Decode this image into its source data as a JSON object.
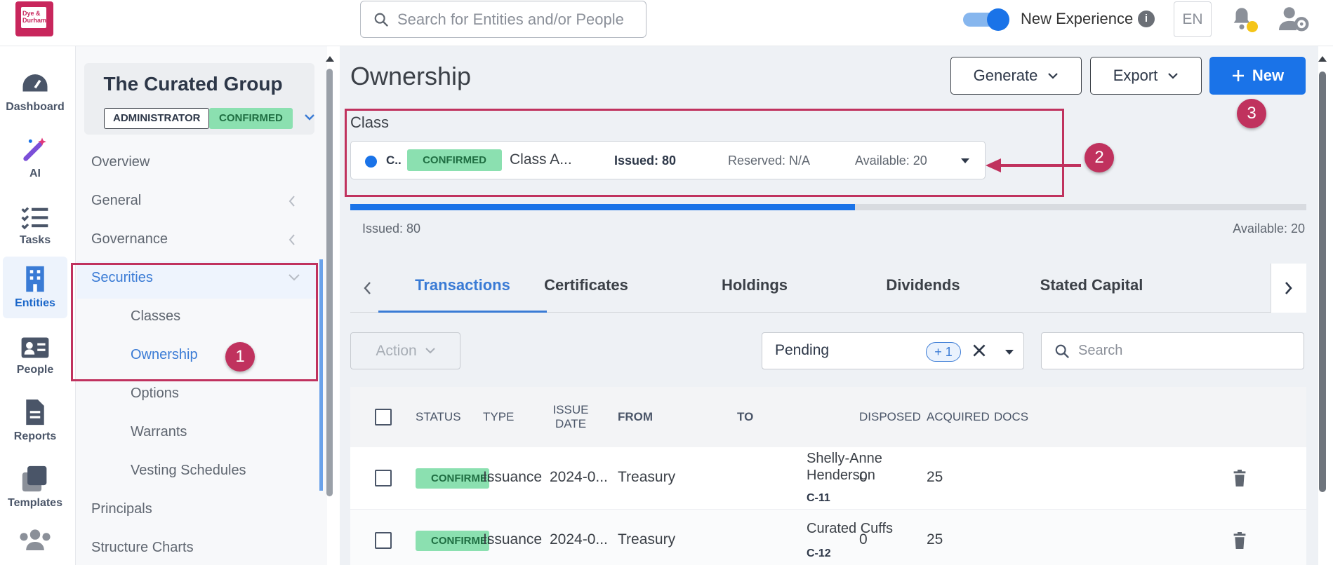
{
  "app": {
    "logo_text": "Dye & Durham",
    "search_placeholder": "Search for Entities and/or People",
    "toggle_label": "New Experience",
    "language": "EN"
  },
  "rail": [
    {
      "label": "Dashboard",
      "icon": "dashboard-icon"
    },
    {
      "label": "AI",
      "icon": "ai-wand-icon"
    },
    {
      "label": "Tasks",
      "icon": "tasks-icon"
    },
    {
      "label": "Entities",
      "icon": "building-icon",
      "active": true
    },
    {
      "label": "People",
      "icon": "id-card-icon"
    },
    {
      "label": "Reports",
      "icon": "report-icon"
    },
    {
      "label": "Templates",
      "icon": "templates-icon"
    }
  ],
  "entity": {
    "name": "The Curated Group",
    "role_badge": "ADMINISTRATOR",
    "status_badge": "CONFIRMED"
  },
  "nav": {
    "overview": "Overview",
    "general": "General",
    "governance": "Governance",
    "securities": "Securities",
    "classes": "Classes",
    "ownership": "Ownership",
    "options": "Options",
    "warrants": "Warrants",
    "vesting": "Vesting Schedules",
    "principals": "Principals",
    "structure": "Structure Charts"
  },
  "main": {
    "title": "Ownership",
    "generate_label": "Generate",
    "export_label": "Export",
    "new_label": "New",
    "class_label": "Class",
    "class_select": {
      "short": "C..",
      "status": "CONFIRMED",
      "name": "Class A...",
      "issued": "Issued: 80",
      "reserved": "Reserved: N/A",
      "available": "Available: 20"
    },
    "progress": {
      "issued": 80,
      "total": 100,
      "issued_label": "Issued: 80",
      "available_label": "Available: 20"
    },
    "tabs": [
      "Transactions",
      "Certificates",
      "Holdings",
      "Dividends",
      "Stated Capital"
    ],
    "action_label": "Action",
    "filter_value": "Pending",
    "filter_chip": "+ 1",
    "search_placeholder": "Search",
    "columns": {
      "status": "STATUS",
      "type": "TYPE",
      "issue_date": "ISSUE DATE",
      "from": "FROM",
      "to": "TO",
      "disposed": "DISPOSED",
      "acquired": "ACQUIRED",
      "docs": "DOCS"
    },
    "rows": [
      {
        "status": "CONFIRMED",
        "type": "Issuance",
        "date": "2024-0...",
        "from": "Treasury",
        "to": "Shelly-Anne Henderson",
        "code": "C-11",
        "disposed": "0",
        "acquired": "25"
      },
      {
        "status": "CONFIRMED",
        "type": "Issuance",
        "date": "2024-0...",
        "from": "Treasury",
        "to": "Curated Cuffs",
        "code": "C-12",
        "disposed": "0",
        "acquired": "25"
      }
    ]
  },
  "annotations": [
    "1",
    "2",
    "3"
  ]
}
